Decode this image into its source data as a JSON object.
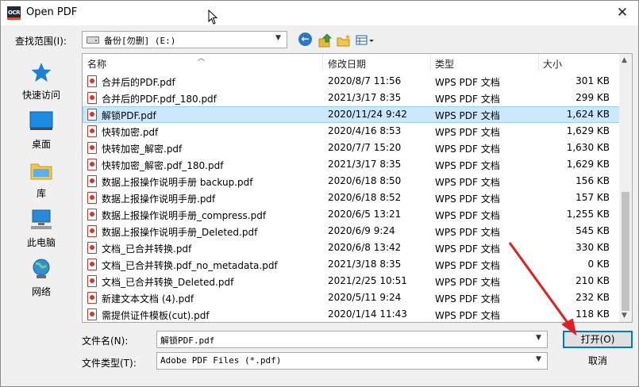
{
  "window": {
    "title": "Open PDF",
    "app_icon_text": "OCR"
  },
  "lookin": {
    "label": "查找范围(I):",
    "value": "备份[勿删] (E:)"
  },
  "places": [
    {
      "label": "快速访问",
      "icon": "star-icon"
    },
    {
      "label": "桌面",
      "icon": "desktop-icon"
    },
    {
      "label": "库",
      "icon": "library-icon"
    },
    {
      "label": "此电脑",
      "icon": "computer-icon"
    },
    {
      "label": "网络",
      "icon": "network-icon"
    }
  ],
  "columns": {
    "name": "名称",
    "date": "修改日期",
    "type": "类型",
    "size": "大小"
  },
  "files": [
    {
      "name": "合并后的PDF.pdf",
      "date": "2020/8/7 11:56",
      "type": "WPS PDF 文档",
      "size": "301 KB"
    },
    {
      "name": "合并后的PDF.pdf_180.pdf",
      "date": "2021/3/17 8:35",
      "type": "WPS PDF 文档",
      "size": "299 KB"
    },
    {
      "name": "解锁PDF.pdf",
      "date": "2020/11/24 9:42",
      "type": "WPS PDF 文档",
      "size": "1,624 KB",
      "selected": true
    },
    {
      "name": "快转加密.pdf",
      "date": "2020/4/16 8:53",
      "type": "WPS PDF 文档",
      "size": "1,629 KB"
    },
    {
      "name": "快转加密_解密.pdf",
      "date": "2020/7/7 15:20",
      "type": "WPS PDF 文档",
      "size": "1,630 KB"
    },
    {
      "name": "快转加密_解密.pdf_180.pdf",
      "date": "2021/3/17 8:35",
      "type": "WPS PDF 文档",
      "size": "1,629 KB"
    },
    {
      "name": "数据上报操作说明手册 backup.pdf",
      "date": "2020/6/18 8:50",
      "type": "WPS PDF 文档",
      "size": "156 KB"
    },
    {
      "name": "数据上报操作说明手册.pdf",
      "date": "2020/6/18 8:52",
      "type": "WPS PDF 文档",
      "size": "157 KB"
    },
    {
      "name": "数据上报操作说明手册_compress.pdf",
      "date": "2020/6/5 13:21",
      "type": "WPS PDF 文档",
      "size": "1,255 KB"
    },
    {
      "name": "数据上报操作说明手册_Deleted.pdf",
      "date": "2020/6/9 9:24",
      "type": "WPS PDF 文档",
      "size": "545 KB"
    },
    {
      "name": "文档_已合并转换.pdf",
      "date": "2020/6/8 13:42",
      "type": "WPS PDF 文档",
      "size": "330 KB"
    },
    {
      "name": "文档_已合并转换.pdf_no_metadata.pdf",
      "date": "2021/3/18 8:35",
      "type": "WPS PDF 文档",
      "size": "0 KB"
    },
    {
      "name": "文档_已合并转换_Deleted.pdf",
      "date": "2021/2/25 10:51",
      "type": "WPS PDF 文档",
      "size": "210 KB"
    },
    {
      "name": "新建文本文档 (4).pdf",
      "date": "2020/5/11 9:24",
      "type": "WPS PDF 文档",
      "size": "232 KB"
    },
    {
      "name": "需提供证件模板(cut).pdf",
      "date": "2020/1/14 11:43",
      "type": "WPS PDF 文档",
      "size": "118 KB"
    }
  ],
  "filename": {
    "label": "文件名(N):",
    "value": "解锁PDF.pdf"
  },
  "filetype": {
    "label": "文件类型(T):",
    "value": "Adobe PDF Files (*.pdf)"
  },
  "buttons": {
    "open": "打开(O)",
    "cancel": "取消"
  },
  "colors": {
    "selection": "#cce8ff",
    "accent": "#0078d7",
    "annotation_arrow": "#e02020"
  }
}
